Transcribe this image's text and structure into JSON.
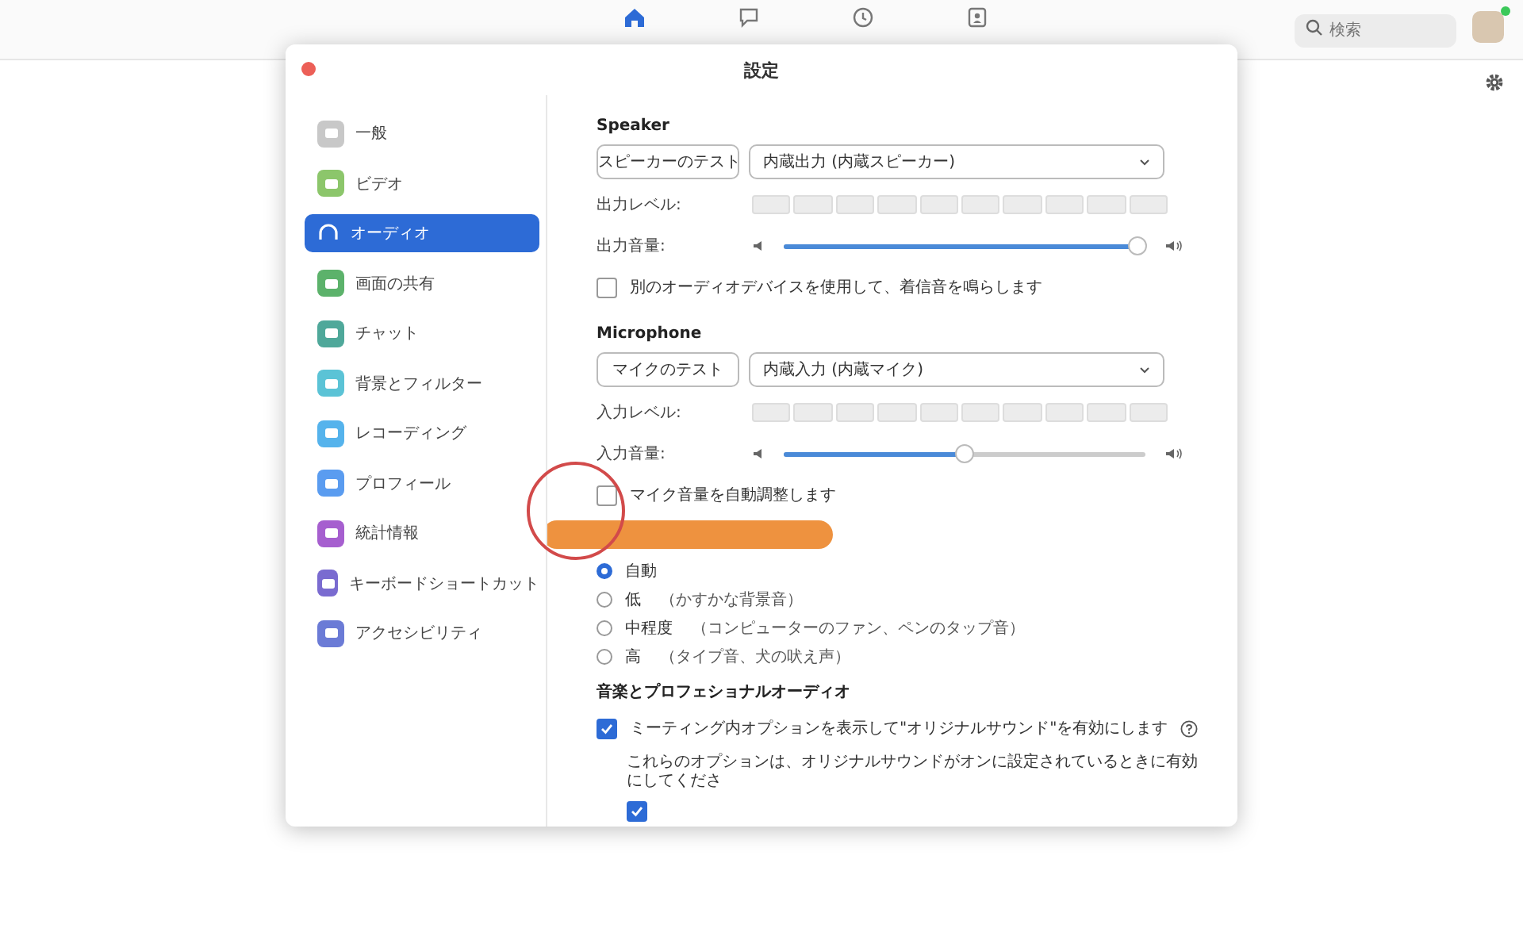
{
  "top_nav": [
    {
      "selected": true
    },
    {
      "selected": false
    },
    {
      "selected": false
    },
    {
      "selected": false
    }
  ],
  "search": {
    "placeholder": "検索"
  },
  "window": {
    "title": "設定"
  },
  "sidebar": {
    "items": [
      {
        "label": "一般",
        "color": "#c8c8c8",
        "selected": false
      },
      {
        "label": "ビデオ",
        "color": "#8cc66b",
        "selected": false
      },
      {
        "label": "オーディオ",
        "color": "#2d6bd6",
        "selected": true
      },
      {
        "label": "画面の共有",
        "color": "#5cb26b",
        "selected": false
      },
      {
        "label": "チャット",
        "color": "#4fa89a",
        "selected": false
      },
      {
        "label": "背景とフィルター",
        "color": "#5bc3d6",
        "selected": false
      },
      {
        "label": "レコーディング",
        "color": "#55b3ec",
        "selected": false
      },
      {
        "label": "プロフィール",
        "color": "#5a9cf0",
        "selected": false
      },
      {
        "label": "統計情報",
        "color": "#a65fcf",
        "selected": false
      },
      {
        "label": "キーボードショートカット",
        "color": "#7a6bd0",
        "selected": false
      },
      {
        "label": "アクセシビリティ",
        "color": "#6b7bd6",
        "selected": false
      }
    ]
  },
  "speaker": {
    "heading": "Speaker",
    "test_button": "スピーカーのテスト",
    "device": "内蔵出力 (内蔵スピーカー)",
    "level_label": "出力レベル:",
    "volume_label": "出力音量:",
    "volume": {
      "level": 0.98
    },
    "checkbox": {
      "label": "別のオーディオデバイスを使用して、着信音を鳴らします",
      "checked": false
    }
  },
  "microphone": {
    "heading": "Microphone",
    "test_button": "マイクのテスト",
    "device": "内蔵入力 (内蔵マイク)",
    "level_label": "入力レベル:",
    "volume_label": "入力音量:",
    "volume": {
      "level": 0.5
    },
    "checkbox": {
      "label": "マイク音量を自動調整します",
      "checked": false
    }
  },
  "noise_options": [
    {
      "label": "自動",
      "selected": true
    },
    {
      "label": "低",
      "note": "（かすかな背景音）",
      "selected": false
    },
    {
      "label": "中程度",
      "note": "（コンピューターのファン、ペンのタップ音）",
      "selected": false
    },
    {
      "label": "高",
      "note": "（タイプ音、犬の吠え声）",
      "selected": false
    }
  ],
  "music": {
    "heading": "音楽とプロフェショナルオーディオ",
    "option": {
      "label": "ミーティング内オプションを表示して\"オリジナルサウンド\"を有効にします",
      "checked": true
    },
    "note": "これらのオプションは、オリジナルサウンドがオンに設定されているときに有効にしてくださ",
    "sub_option": {
      "checked": true
    }
  }
}
